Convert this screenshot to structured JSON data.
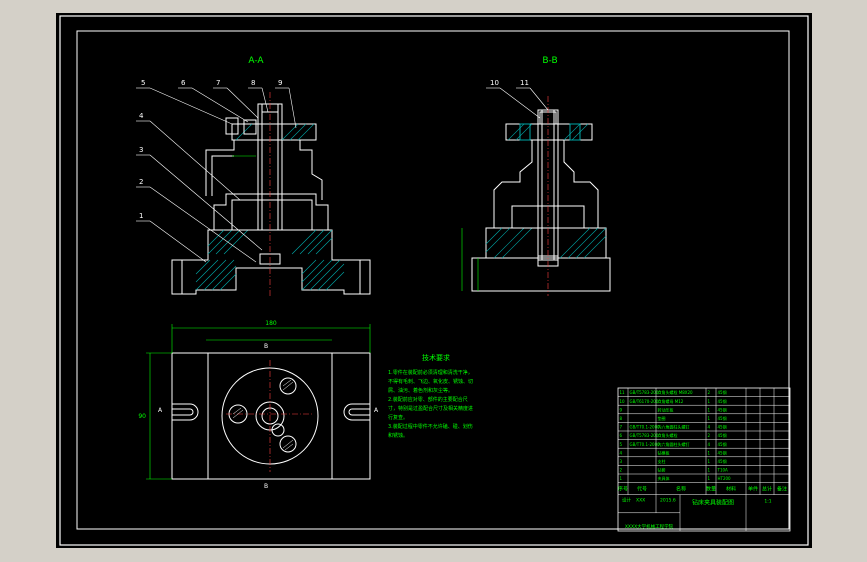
{
  "colors": {
    "viewport_bg": "#000000",
    "frame": "#ffffff",
    "title_text": "#00ff00",
    "part_lines": "#ffffff",
    "hatch": "#00a6a6",
    "dims": "#00ff00",
    "leaders": "#ffffff"
  },
  "sections": {
    "aa_label": "A-A",
    "bb_label": "B-B"
  },
  "balloons": [
    "1",
    "2",
    "3",
    "4",
    "5",
    "6",
    "7",
    "8",
    "9",
    "10",
    "11"
  ],
  "plan": {
    "dim_top": "180",
    "dim_left": "90",
    "cut_a_top": "B",
    "cut_b_bottom": "B",
    "cut_a_left": "A",
    "cut_a_right": "A"
  },
  "notes": {
    "title": "技术要求",
    "lines": [
      "1.零件在装配前必须清理和清洗干净，",
      "不得有毛刺、飞边、氧化皮、锈蚀、切",
      "屑、油污、着色剂和灰尘等。",
      "2.装配前应对零、部件的主要配合尺",
      "寸，特别是过盈配合尺寸及相关精度进",
      "行复查。",
      "3.装配过程中零件不允许磕、碰、划伤",
      "和锈蚀。"
    ]
  },
  "bom": {
    "rows": [
      {
        "no": "11",
        "code": "GB/T5783-2000",
        "name": "六角头螺栓 M8X20",
        "qty": "2",
        "mat": "45钢"
      },
      {
        "no": "10",
        "code": "GB/T6170-2000",
        "name": "六角螺母 M12",
        "qty": "1",
        "mat": "45钢"
      },
      {
        "no": "9",
        "code": "",
        "name": "转动压板",
        "qty": "1",
        "mat": "45钢"
      },
      {
        "no": "8",
        "code": "",
        "name": "垫圈",
        "qty": "1",
        "mat": "45钢"
      },
      {
        "no": "7",
        "code": "GB/T70.1-2000",
        "name": "内六角圆柱头螺钉",
        "qty": "4",
        "mat": "45钢"
      },
      {
        "no": "6",
        "code": "GB/T5783-2000",
        "name": "六角头螺栓",
        "qty": "2",
        "mat": "45钢"
      },
      {
        "no": "5",
        "code": "GB/T70.1-2000",
        "name": "内六角圆柱头螺钉",
        "qty": "4",
        "mat": "45钢"
      },
      {
        "no": "4",
        "code": "",
        "name": "钻模板",
        "qty": "1",
        "mat": "45钢"
      },
      {
        "no": "3",
        "code": "",
        "name": "支柱",
        "qty": "1",
        "mat": "45钢"
      },
      {
        "no": "2",
        "code": "",
        "name": "钻套",
        "qty": "1",
        "mat": "T10A"
      },
      {
        "no": "1",
        "code": "",
        "name": "夹具体",
        "qty": "1",
        "mat": "HT200"
      }
    ],
    "header": {
      "no": "序号",
      "code": "代号",
      "name": "名称",
      "qty": "数量",
      "mat": "材料",
      "unit": "单件",
      "total": "总计",
      "remark": "备注"
    },
    "title_block": {
      "designer_label": "设计",
      "designer_name": "XXX",
      "date": "2015.6",
      "drawing_name": "钻床夹具装配图",
      "scale": "1:1",
      "school": "XXXX大学机械工程学院"
    }
  }
}
